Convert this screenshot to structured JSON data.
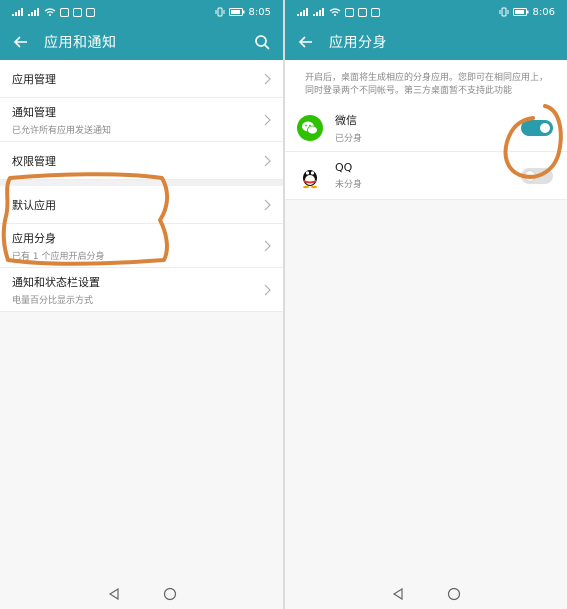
{
  "colors": {
    "accent": "#2a9cab",
    "annotation": "#d9843a"
  },
  "left": {
    "status": {
      "time": "8:05"
    },
    "app_bar": {
      "title": "应用和通知"
    },
    "items": [
      {
        "title": "应用管理",
        "subtitle": ""
      },
      {
        "title": "通知管理",
        "subtitle": "已允许所有应用发送通知"
      },
      {
        "title": "权限管理",
        "subtitle": ""
      },
      {
        "title": "默认应用",
        "subtitle": ""
      },
      {
        "title": "应用分身",
        "subtitle": "已有 1 个应用开启分身"
      },
      {
        "title": "通知和状态栏设置",
        "subtitle": "电量百分比显示方式"
      }
    ]
  },
  "right": {
    "status": {
      "time": "8:06"
    },
    "app_bar": {
      "title": "应用分身"
    },
    "description": "开启后，桌面将生成相应的分身应用。您即可在相同应用上，同时登录两个不同帐号。第三方桌面暂不支持此功能",
    "apps": [
      {
        "name": "微信",
        "state": "已分身",
        "enabled": true,
        "icon": "wechat-icon"
      },
      {
        "name": "QQ",
        "state": "未分身",
        "enabled": false,
        "icon": "qq-icon"
      }
    ]
  }
}
